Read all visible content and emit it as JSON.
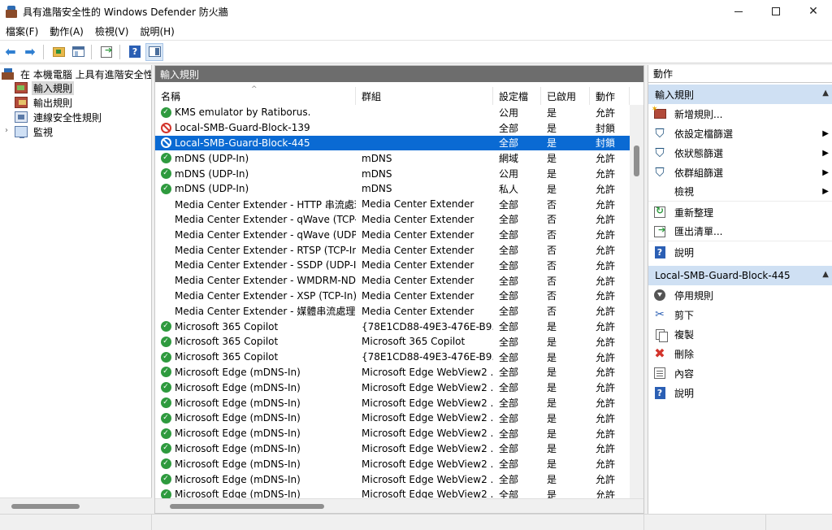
{
  "window": {
    "title": "具有進階安全性的 Windows Defender 防火牆",
    "minimize_label": "",
    "maximize_label": "",
    "close_label": "✕"
  },
  "menu": [
    "檔案(F)",
    "動作(A)",
    "檢視(V)",
    "說明(H)"
  ],
  "toolbar": {
    "back_icon": "back-arrow-icon",
    "forward_icon": "forward-arrow-icon",
    "help_label": "?"
  },
  "tree": {
    "root": "在 本機電腦 上具有進階安全性的 Windows Defender 防火牆",
    "items": [
      {
        "label": "輸入規則",
        "selected": true
      },
      {
        "label": "輸出規則",
        "selected": false
      },
      {
        "label": "連線安全性規則",
        "selected": false
      },
      {
        "label": "監視",
        "selected": false
      }
    ],
    "expander": "›"
  },
  "main": {
    "header": "輸入規則",
    "columns": [
      "名稱",
      "群組",
      "設定檔",
      "已啟用",
      "動作"
    ],
    "sort_indicator": "^",
    "rows": [
      {
        "icon": "allow",
        "name": "KMS emulator by Ratiborus.",
        "group": "",
        "profile": "公用",
        "enabled": "是",
        "action": "允許"
      },
      {
        "icon": "block",
        "name": "Local-SMB-Guard-Block-139",
        "group": "",
        "profile": "全部",
        "enabled": "是",
        "action": "封鎖"
      },
      {
        "icon": "block",
        "name": "Local-SMB-Guard-Block-445",
        "group": "",
        "profile": "全部",
        "enabled": "是",
        "action": "封鎖",
        "selected": true
      },
      {
        "icon": "allow",
        "name": "mDNS (UDP-In)",
        "group": "mDNS",
        "profile": "網域",
        "enabled": "是",
        "action": "允許"
      },
      {
        "icon": "allow",
        "name": "mDNS (UDP-In)",
        "group": "mDNS",
        "profile": "公用",
        "enabled": "是",
        "action": "允許"
      },
      {
        "icon": "allow",
        "name": "mDNS (UDP-In)",
        "group": "mDNS",
        "profile": "私人",
        "enabled": "是",
        "action": "允許"
      },
      {
        "icon": "none",
        "name": "Media Center Extender - HTTP 串流處理...",
        "group": "Media Center Extender",
        "profile": "全部",
        "enabled": "否",
        "action": "允許"
      },
      {
        "icon": "none",
        "name": "Media Center Extender - qWave (TCP-In)",
        "group": "Media Center Extender",
        "profile": "全部",
        "enabled": "否",
        "action": "允許"
      },
      {
        "icon": "none",
        "name": "Media Center Extender - qWave (UDP-In)",
        "group": "Media Center Extender",
        "profile": "全部",
        "enabled": "否",
        "action": "允許"
      },
      {
        "icon": "none",
        "name": "Media Center Extender - RTSP (TCP-In)",
        "group": "Media Center Extender",
        "profile": "全部",
        "enabled": "否",
        "action": "允許"
      },
      {
        "icon": "none",
        "name": "Media Center Extender - SSDP (UDP-In)",
        "group": "Media Center Extender",
        "profile": "全部",
        "enabled": "否",
        "action": "允許"
      },
      {
        "icon": "none",
        "name": "Media Center Extender - WMDRM-ND/...",
        "group": "Media Center Extender",
        "profile": "全部",
        "enabled": "否",
        "action": "允許"
      },
      {
        "icon": "none",
        "name": "Media Center Extender - XSP (TCP-In)",
        "group": "Media Center Extender",
        "profile": "全部",
        "enabled": "否",
        "action": "允許"
      },
      {
        "icon": "none",
        "name": "Media Center Extender - 媒體串流處理 (...",
        "group": "Media Center Extender",
        "profile": "全部",
        "enabled": "否",
        "action": "允許"
      },
      {
        "icon": "allow",
        "name": "Microsoft 365 Copilot",
        "group": "{78E1CD88-49E3-476E-B9...",
        "profile": "全部",
        "enabled": "是",
        "action": "允許"
      },
      {
        "icon": "allow",
        "name": "Microsoft 365 Copilot",
        "group": "Microsoft 365 Copilot",
        "profile": "全部",
        "enabled": "是",
        "action": "允許"
      },
      {
        "icon": "allow",
        "name": "Microsoft 365 Copilot",
        "group": "{78E1CD88-49E3-476E-B9...",
        "profile": "全部",
        "enabled": "是",
        "action": "允許"
      },
      {
        "icon": "allow",
        "name": "Microsoft Edge (mDNS-In)",
        "group": "Microsoft Edge WebView2 ...",
        "profile": "全部",
        "enabled": "是",
        "action": "允許"
      },
      {
        "icon": "allow",
        "name": "Microsoft Edge (mDNS-In)",
        "group": "Microsoft Edge WebView2 ...",
        "profile": "全部",
        "enabled": "是",
        "action": "允許"
      },
      {
        "icon": "allow",
        "name": "Microsoft Edge (mDNS-In)",
        "group": "Microsoft Edge WebView2 ...",
        "profile": "全部",
        "enabled": "是",
        "action": "允許"
      },
      {
        "icon": "allow",
        "name": "Microsoft Edge (mDNS-In)",
        "group": "Microsoft Edge WebView2 ...",
        "profile": "全部",
        "enabled": "是",
        "action": "允許"
      },
      {
        "icon": "allow",
        "name": "Microsoft Edge (mDNS-In)",
        "group": "Microsoft Edge WebView2 ...",
        "profile": "全部",
        "enabled": "是",
        "action": "允許"
      },
      {
        "icon": "allow",
        "name": "Microsoft Edge (mDNS-In)",
        "group": "Microsoft Edge WebView2 ...",
        "profile": "全部",
        "enabled": "是",
        "action": "允許"
      },
      {
        "icon": "allow",
        "name": "Microsoft Edge (mDNS-In)",
        "group": "Microsoft Edge WebView2 ...",
        "profile": "全部",
        "enabled": "是",
        "action": "允許"
      },
      {
        "icon": "allow",
        "name": "Microsoft Edge (mDNS-In)",
        "group": "Microsoft Edge WebView2 ...",
        "profile": "全部",
        "enabled": "是",
        "action": "允許"
      },
      {
        "icon": "allow",
        "name": "Microsoft Edge (mDNS-In)",
        "group": "Microsoft Edge WebView2 ...",
        "profile": "全部",
        "enabled": "是",
        "action": "允許"
      }
    ]
  },
  "actions": {
    "title": "動作",
    "section1": {
      "title": "輸入規則",
      "items": [
        {
          "label": "新增規則...",
          "icon": "new-rule-icon",
          "submenu": false
        },
        {
          "label": "依設定檔篩選",
          "icon": "filter-icon",
          "submenu": true
        },
        {
          "label": "依狀態篩選",
          "icon": "filter-icon",
          "submenu": true
        },
        {
          "label": "依群組篩選",
          "icon": "filter-icon",
          "submenu": true
        },
        {
          "label": "檢視",
          "icon": "",
          "submenu": true
        },
        {
          "label": "重新整理",
          "icon": "refresh-icon",
          "submenu": false
        },
        {
          "label": "匯出清單...",
          "icon": "export-icon",
          "submenu": false
        },
        {
          "label": "說明",
          "icon": "help-icon",
          "submenu": false
        }
      ]
    },
    "section2": {
      "title": "Local-SMB-Guard-Block-445",
      "items": [
        {
          "label": "停用規則",
          "icon": "disable-icon"
        },
        {
          "label": "剪下",
          "icon": "cut-icon"
        },
        {
          "label": "複製",
          "icon": "copy-icon"
        },
        {
          "label": "刪除",
          "icon": "delete-icon"
        },
        {
          "label": "內容",
          "icon": "properties-icon"
        },
        {
          "label": "說明",
          "icon": "help-icon"
        }
      ]
    },
    "collapse_glyph": "▲",
    "submenu_glyph": "▶",
    "help_glyph": "?",
    "cut_glyph": "✂",
    "delete_glyph": "✖",
    "filter_glyph": "⛉"
  },
  "colors": {
    "selection": "#0a6ad3",
    "header_band": "#6d6d6d",
    "section_head": "#cfe0f3",
    "allow_green": "#2e9a3e",
    "block_red": "#d3342b"
  }
}
